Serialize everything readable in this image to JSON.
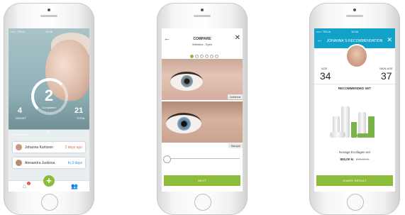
{
  "phone1": {
    "status": {
      "carrier": "••••○ TELIA",
      "time": "16:28"
    },
    "hero": {
      "score": "2",
      "label": "Completed"
    },
    "stats": {
      "target": {
        "value": "4",
        "label": "TARGET"
      },
      "total": {
        "value": "21",
        "label": "TOTAL"
      }
    },
    "list_header": "Follow ups",
    "followups": [
      {
        "name": "Johanna Karlsson",
        "date": "2 days ago",
        "date_color": "#e86a4a"
      },
      {
        "name": "Alexandra Juskova",
        "date": "In 3 days",
        "date_color": "#12a2c9"
      }
    ],
    "tabbar": {
      "badge": "2"
    },
    "icons": {
      "home": "home-icon",
      "add": "plus-icon",
      "clients": "people-icon"
    },
    "accent": "#8bbd3a"
  },
  "phone2": {
    "title": "COMPARE",
    "subtitle": "Wrinkles - Eyes",
    "images": [
      {
        "tag": "Johanna"
      },
      {
        "tag": "Sample"
      }
    ],
    "button_label": "NEXT"
  },
  "phone3": {
    "status": {
      "carrier": "••••○ TELIA",
      "time": "16:28"
    },
    "title": "JOHANNA´S RECOMMENDATION",
    "age_label": "AGE",
    "age_value": "34",
    "skin_age_label": "SKIN AGE",
    "skin_age_value": "37",
    "section_title": "RECOMMENDED SET",
    "product_name": "Novage Ecollagen set",
    "price": "800,00 kr",
    "old_price": "920,00 kr",
    "button_label": "SHARE RESULT",
    "header_color": "#12a2c9"
  }
}
